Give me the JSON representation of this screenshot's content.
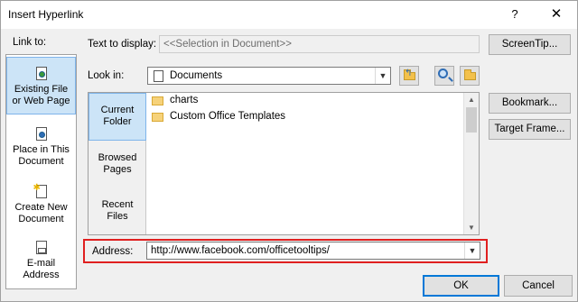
{
  "window": {
    "title": "Insert Hyperlink",
    "help_glyph": "?",
    "close_glyph": "✕"
  },
  "link_to": {
    "label": "Link to:",
    "items": [
      {
        "line1": "Existing File",
        "line2": "or Web Page",
        "icon": "web-page-icon",
        "selected": true
      },
      {
        "line1": "Place in This",
        "line2": "Document",
        "icon": "document-place-icon",
        "selected": false
      },
      {
        "line1": "Create New",
        "line2": "Document",
        "icon": "new-document-icon",
        "selected": false
      },
      {
        "line1": "E-mail",
        "line2": "Address",
        "icon": "email-icon",
        "selected": false
      }
    ]
  },
  "text_to_display": {
    "label": "Text to display:",
    "value": "<<Selection in Document>>"
  },
  "screentip_button": "ScreenTip...",
  "look_in": {
    "label": "Look in:",
    "value": "Documents"
  },
  "browse_nav": [
    {
      "line1": "Current",
      "line2": "Folder",
      "selected": true
    },
    {
      "line1": "Browsed",
      "line2": "Pages",
      "selected": false
    },
    {
      "line1": "Recent",
      "line2": "Files",
      "selected": false
    }
  ],
  "files": [
    {
      "name": "charts",
      "icon": "folder-icon"
    },
    {
      "name": "Custom Office Templates",
      "icon": "folder-icon"
    }
  ],
  "side_buttons": {
    "bookmark": "Bookmark...",
    "target_frame": "Target Frame..."
  },
  "address": {
    "label": "Address:",
    "value": "http://www.facebook.com/officetooltips/"
  },
  "ok_button": "OK",
  "cancel_button": "Cancel",
  "colors": {
    "highlight": "#e02020",
    "selection": "#cce4f7",
    "default_button_border": "#0078d7"
  }
}
